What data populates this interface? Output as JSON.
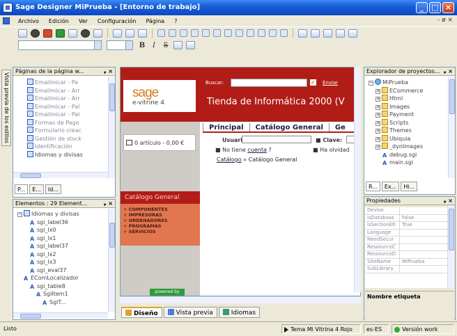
{
  "window": {
    "title": "Sage Designer MiPrueba - [Entorno de trabajo]",
    "controls": {
      "minimize": "_",
      "maximize": "□",
      "close": "×"
    }
  },
  "menu": {
    "items": [
      "Archivo",
      "Edición",
      "Ver",
      "Configuración",
      "Página",
      "?"
    ],
    "right": "- ø ×"
  },
  "format_toolbar": {
    "b": "B",
    "i": "I",
    "s": "S"
  },
  "side_tab": {
    "label": "Vista previa de los estilos"
  },
  "pages_panel": {
    "title": "Páginas de la página w...",
    "pin": "ᵩ ×",
    "items": [
      {
        "label": "Emailmicar - Pa",
        "dim": true
      },
      {
        "label": "Emailmicar - Arr",
        "dim": true
      },
      {
        "label": "Emailmicar - Arr",
        "dim": true
      },
      {
        "label": "Emailmicar - Pal",
        "dim": true
      },
      {
        "label": "Emailmicar - Pal",
        "dim": true
      },
      {
        "label": "Formas de Pago",
        "dim": true
      },
      {
        "label": "Formulario creac",
        "dim": true
      },
      {
        "label": "Gestión de stock",
        "dim": true
      },
      {
        "label": "Identificación",
        "dim": true
      },
      {
        "label": "Idiomas y divisas",
        "dim": false
      }
    ],
    "tabs": [
      "P...",
      "E...",
      "Id..."
    ]
  },
  "elements_panel": {
    "title": "Elementos : 29 Element...",
    "pin": "ᵩ ×",
    "items": [
      {
        "label": "Idiomas y divisas",
        "indent": 0,
        "kind": "page"
      },
      {
        "label": "sgi_label36",
        "indent": 2,
        "kind": "a"
      },
      {
        "label": "sgi_lx0",
        "indent": 2,
        "kind": "a"
      },
      {
        "label": "sgi_lx1",
        "indent": 2,
        "kind": "a"
      },
      {
        "label": "sgi_label37",
        "indent": 2,
        "kind": "a"
      },
      {
        "label": "sgi_lx2",
        "indent": 2,
        "kind": "a"
      },
      {
        "label": "sgi_lx3",
        "indent": 2,
        "kind": "a"
      },
      {
        "label": "sgi_eval37",
        "indent": 2,
        "kind": "a"
      },
      {
        "label": "EComLocalizador",
        "indent": 1,
        "kind": "a"
      },
      {
        "label": "sgi_table8",
        "indent": 2,
        "kind": "a"
      },
      {
        "label": "SgiItem1",
        "indent": 3,
        "kind": "a"
      },
      {
        "label": "SgiT...",
        "indent": 4,
        "kind": "a"
      }
    ]
  },
  "canvas": {
    "logo_text": "sage",
    "logo_sub": "e-vitrine 4",
    "buscar_label": "Buscar:",
    "check_mark": "✓",
    "enviar_label": "Enviar",
    "store_title": "Tienda de Informática 2000 (V",
    "nav": [
      "Principal",
      "Catálogo General",
      "Ge"
    ],
    "cart": "0 artículo - 0,00 €",
    "usuario_label": "Usuario:",
    "clave_label": "Clave:",
    "no_cuenta_prefix": "No tiene ",
    "no_cuenta_link": "cuenta",
    "no_cuenta_suffix": " ?",
    "olvido": "Ha olvidad",
    "crumb_link": "Catálogo",
    "crumb_rest": " » Catálogo General",
    "catalog_header": "Catálogo General",
    "catalog_items": [
      "COMPONENTES",
      "IMPRESORAS",
      "ORDENADORES",
      "PROGRAMAS",
      "SERVICIOS"
    ],
    "powered": "powered by"
  },
  "view_tabs": [
    "Diseño",
    "Vista previa",
    "Idiomas"
  ],
  "explorer_panel": {
    "title": "Explorador de proyectos...",
    "pin": "ᵩ ×",
    "items": [
      {
        "label": "MiPrueba",
        "indent": 0,
        "kind": "globe"
      },
      {
        "label": "ECommerce",
        "indent": 1,
        "kind": "folder"
      },
      {
        "label": "Html",
        "indent": 1,
        "kind": "folder"
      },
      {
        "label": "Images",
        "indent": 1,
        "kind": "folder"
      },
      {
        "label": "Payment",
        "indent": 1,
        "kind": "folder"
      },
      {
        "label": "Scripts",
        "indent": 1,
        "kind": "folder"
      },
      {
        "label": "Themes",
        "indent": 1,
        "kind": "folder"
      },
      {
        "label": "Ubiquia",
        "indent": 1,
        "kind": "folder"
      },
      {
        "label": "_dynImages",
        "indent": 1,
        "kind": "folder"
      },
      {
        "label": "debug.sgi",
        "indent": 2,
        "kind": "a"
      },
      {
        "label": "main.sgi",
        "indent": 2,
        "kind": "a"
      }
    ],
    "tabs": [
      "R...",
      "Ex...",
      "Hi..."
    ]
  },
  "properties_panel": {
    "title": "Propiedades",
    "pin": "ᵩ ×",
    "rows": [
      {
        "key": "Devise",
        "value": ""
      },
      {
        "key": "isDatabase",
        "value": "False"
      },
      {
        "key": "isSectionElt",
        "value": "True"
      },
      {
        "key": "Language",
        "value": ""
      },
      {
        "key": "NeedSecur",
        "value": ""
      },
      {
        "key": "RessourceC",
        "value": ""
      },
      {
        "key": "RessourceD",
        "value": ""
      },
      {
        "key": "SiteName",
        "value": "MiPrueba"
      },
      {
        "key": "SubLibrary",
        "value": ""
      }
    ],
    "description_title": "Nombre etiqueta"
  },
  "status": {
    "ready": "Listo",
    "theme": "Tema Mi Vitrina 4 Rojo",
    "locale": "es-ES",
    "version": "Versión work"
  },
  "colors": {
    "title_blue": "#1a5fd8",
    "store_red": "#b11d16",
    "catalog_orange": "#e2764f",
    "sage_orange": "#d47e1e"
  }
}
